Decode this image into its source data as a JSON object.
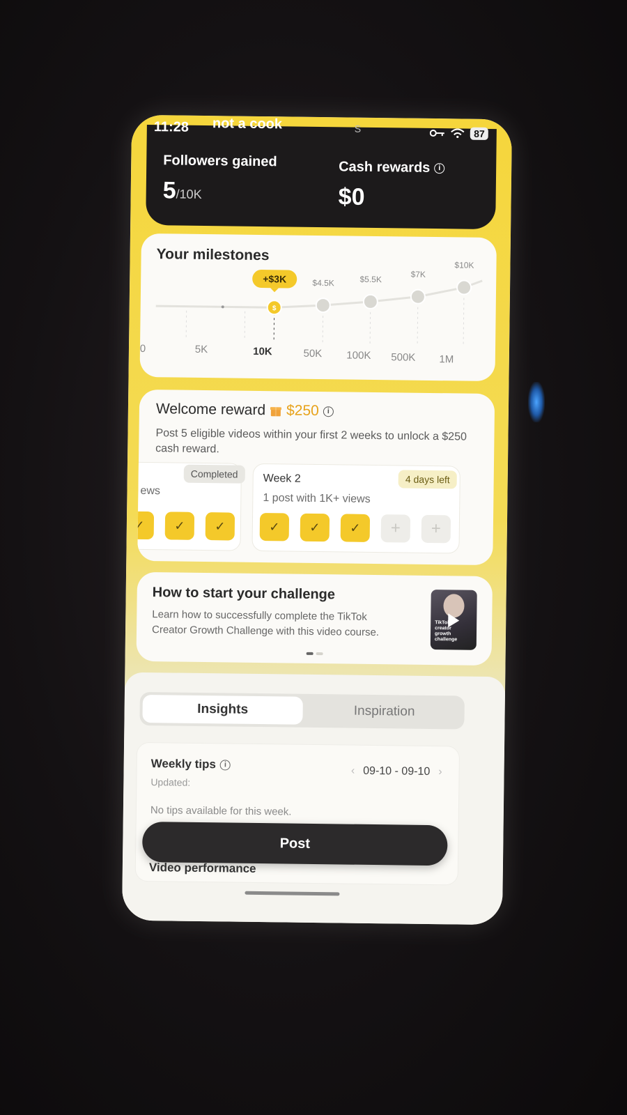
{
  "status": {
    "time": "11:28",
    "notch_label": "not a cook",
    "s_mark": "S",
    "battery": "87"
  },
  "stats": {
    "followers_label": "Followers gained",
    "followers_value": "5",
    "followers_target": "/10K",
    "cash_label": "Cash rewards",
    "cash_value": "$0"
  },
  "milestones": {
    "title": "Your milestones",
    "current_reward": "+$3K",
    "reward_labels": [
      "$4.5K",
      "$5.5K",
      "$7K",
      "$10K"
    ],
    "axis_labels": [
      "0",
      "5K",
      "10K",
      "50K",
      "100K",
      "500K",
      "1M"
    ]
  },
  "welcome_reward": {
    "title": "Welcome reward",
    "amount": "$250",
    "description": "Post 5 eligible videos within your first 2 weeks to unlock a $250 cash reward.",
    "week1": {
      "badge": "Completed",
      "subtitle_fragment": "ews",
      "slots": [
        "done",
        "done",
        "done"
      ]
    },
    "week2": {
      "title": "Week 2",
      "badge": "4 days left",
      "subtitle": "1 post with 1K+ views",
      "slots": [
        "done",
        "done",
        "done",
        "empty",
        "empty"
      ]
    }
  },
  "challenge": {
    "title": "How to start your challenge",
    "description": "Learn how to successfully complete the TikTok Creator Growth Challenge with this video course.",
    "thumbnail_caption": "TikTok creator growth challenge"
  },
  "tabs": {
    "insights": "Insights",
    "inspiration": "Inspiration"
  },
  "tips": {
    "title": "Weekly tips",
    "updated": "Updated:",
    "date_range": "09-10 - 09-10",
    "empty": "No tips available for this week."
  },
  "post_button": "Post",
  "video_performance": "Video performance",
  "colors": {
    "accent_yellow": "#F4C92A",
    "dark_card": "#1C1A1B",
    "reward_orange": "#E7A21A"
  }
}
